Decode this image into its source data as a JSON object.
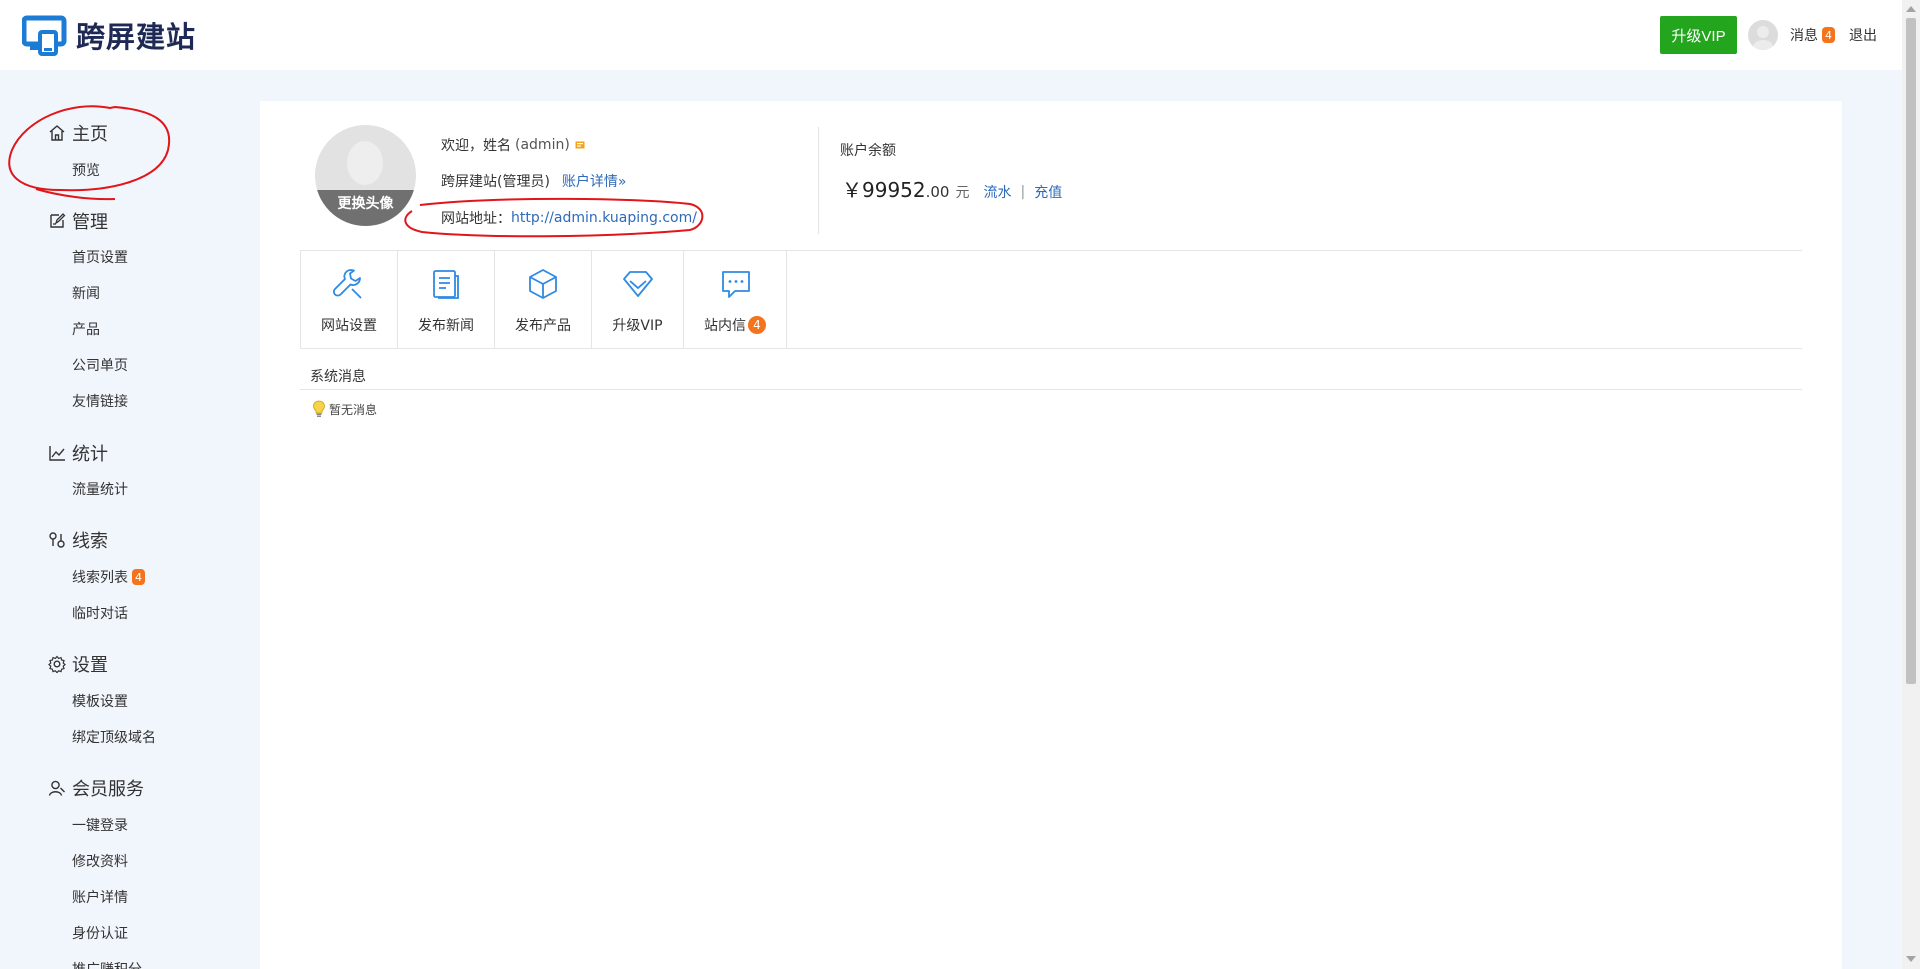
{
  "brand": {
    "name": "跨屏建站",
    "color": "#1c7bd5",
    "text_color": "#1e2a55"
  },
  "header": {
    "vip_button": "升级VIP",
    "vip_color": "#23a51d",
    "messages_label": "消息",
    "messages_count": "4",
    "logout_label": "退出"
  },
  "sidebar": {
    "groups": [
      {
        "title": "主页",
        "icon": "home-icon",
        "items": [
          "预览"
        ]
      },
      {
        "title": "管理",
        "icon": "edit-icon",
        "items": [
          "首页设置",
          "新闻",
          "产品",
          "公司单页",
          "友情链接"
        ]
      },
      {
        "title": "统计",
        "icon": "chart-icon",
        "items": [
          "流量统计"
        ]
      },
      {
        "title": "线索",
        "icon": "lead-icon",
        "items": [
          "线索列表",
          "临时对话"
        ],
        "badge": "4"
      },
      {
        "title": "设置",
        "icon": "gear-icon",
        "items": [
          "模板设置",
          "绑定顶级域名"
        ]
      },
      {
        "title": "会员服务",
        "icon": "user-icon",
        "items": [
          "一键登录",
          "修改资料",
          "账户详情",
          "身份认证",
          "推广赚积分"
        ]
      }
    ]
  },
  "profile": {
    "change_avatar": "更换头像",
    "welcome": "欢迎，姓名",
    "username": "(admin)",
    "role": "跨屏建站(管理员)",
    "account_details": "账户详情»",
    "site_url_label": "网站地址：",
    "site_url": "http://admin.kuaping.com/"
  },
  "balance": {
    "label": "账户余额",
    "currency": "￥",
    "amount": "99952",
    "cents": ".00",
    "unit": "元",
    "flow_link": "流水",
    "separator": "|",
    "recharge_link": "充值"
  },
  "quick_actions": [
    {
      "label": "网站设置",
      "icon": "wrench-icon"
    },
    {
      "label": "发布新闻",
      "icon": "document-icon"
    },
    {
      "label": "发布产品",
      "icon": "cube-icon"
    },
    {
      "label": "升级VIP",
      "icon": "diamond-icon"
    },
    {
      "label": "站内信",
      "icon": "chat-icon",
      "badge": "4"
    }
  ],
  "system_messages": {
    "title": "系统消息",
    "empty_text": "暂无消息"
  },
  "colors": {
    "accent_blue": "#2f8ae2",
    "link": "#2e6ab8",
    "badge": "#f5731b",
    "annotation": "#e0161a"
  }
}
